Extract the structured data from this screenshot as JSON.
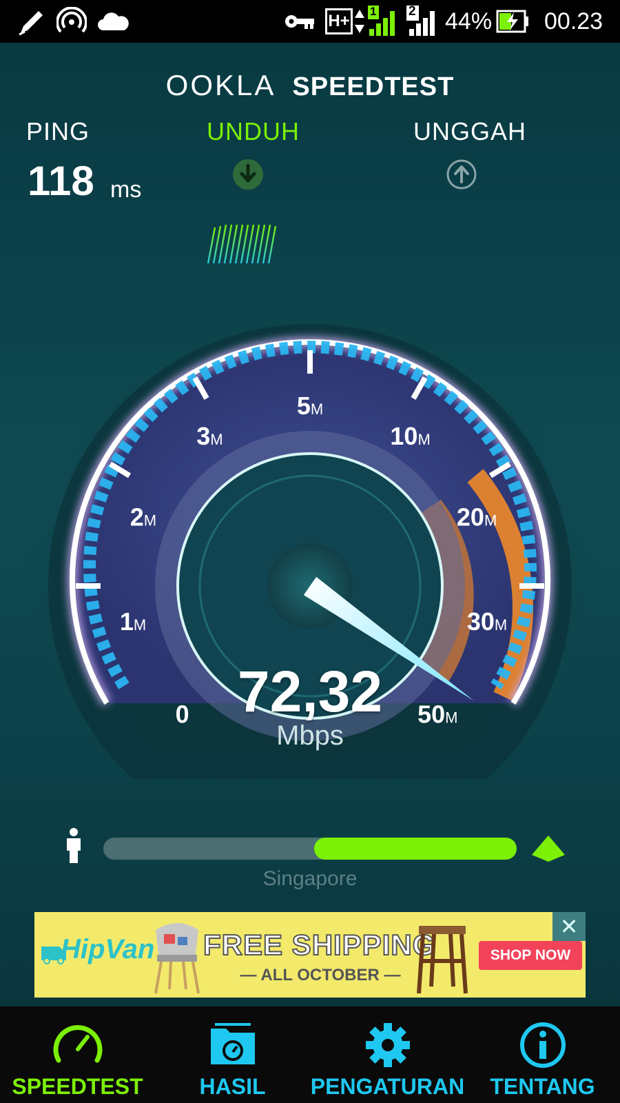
{
  "status_bar": {
    "left_icons": [
      "edit-icon",
      "hotspot-icon",
      "cloud-icon"
    ],
    "right_icons": [
      "vpn-key-icon",
      "network-hplus-icon",
      "signal-sim1-icon",
      "signal-sim2-icon",
      "battery-charging-icon"
    ],
    "network_type": "H+",
    "sim1": "1",
    "sim2": "2",
    "battery": "44%",
    "time": "00.23"
  },
  "header": {
    "brand": "OOKLA",
    "product": "SPEEDTEST"
  },
  "stats": {
    "ping": {
      "label": "PING",
      "value": "118",
      "unit": "ms"
    },
    "download": {
      "label": "UNDUH",
      "icon": "download-arrow-icon",
      "active": true
    },
    "upload": {
      "label": "UNGGAH",
      "icon": "upload-arrow-icon",
      "active": false
    }
  },
  "gauge": {
    "ticks": [
      {
        "label": "0",
        "unit": ""
      },
      {
        "label": "1",
        "unit": "M"
      },
      {
        "label": "2",
        "unit": "M"
      },
      {
        "label": "3",
        "unit": "M"
      },
      {
        "label": "5",
        "unit": "M"
      },
      {
        "label": "10",
        "unit": "M"
      },
      {
        "label": "20",
        "unit": "M"
      },
      {
        "label": "30",
        "unit": "M"
      },
      {
        "label": "50",
        "unit": "M"
      }
    ],
    "speed": "72,32",
    "speed_unit": "Mbps"
  },
  "progress": {
    "fraction": 0.49,
    "server": "Singapore",
    "user_icon": "person-icon",
    "server_icon": "server-triangle-icon"
  },
  "ad": {
    "brand": "HipVan",
    "headline": "FREE SHIPPING",
    "subline": "ALL OCTOBER",
    "cta": "SHOP NOW",
    "close": "✕"
  },
  "nav": {
    "items": [
      {
        "label": "SPEEDTEST",
        "icon": "speedometer-icon",
        "active": true
      },
      {
        "label": "HASIL",
        "icon": "results-folder-icon",
        "active": false
      },
      {
        "label": "PENGATURAN",
        "icon": "gear-icon",
        "active": false
      },
      {
        "label": "TENTANG",
        "icon": "info-icon",
        "active": false
      }
    ]
  },
  "colors": {
    "accent_green": "#7cf007",
    "nav_cyan": "#1ec8f0",
    "gauge_arc": "#c9a8f0",
    "gauge_orange": "#f08a2a"
  }
}
